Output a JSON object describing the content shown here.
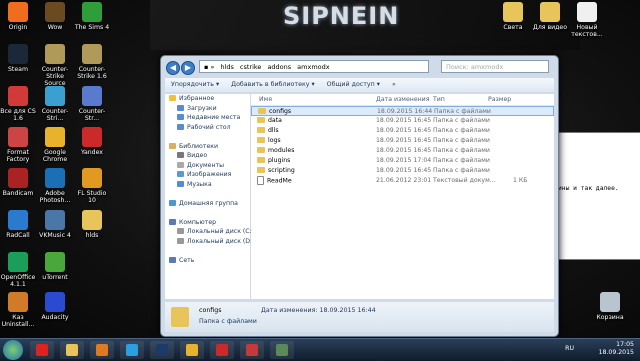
{
  "desktop": {
    "brand": "SIPNEIN",
    "icons_left": [
      {
        "label": "Origin",
        "color": "#f06d1f"
      },
      {
        "label": "Wow",
        "color": "#6b4a22"
      },
      {
        "label": "The Sims 4",
        "color": "#2f9e3a"
      },
      {
        "label": "Steam",
        "color": "#1b2838"
      },
      {
        "label": "Counter-Strike Source",
        "color": "#b09a5a"
      },
      {
        "label": "Counter-Strike 1.6",
        "color": "#b09a5a"
      },
      {
        "label": "Все для CS 1.6",
        "color": "#d23a3a"
      },
      {
        "label": "Counter-Stri...",
        "color": "#3aa0d0"
      },
      {
        "label": "Counter-Str...",
        "color": "#5a7ad0"
      },
      {
        "label": "Format Factory",
        "color": "#c44"
      },
      {
        "label": "Google Chrome",
        "color": "#e8b32a"
      },
      {
        "label": "Yandex",
        "color": "#cc2a2a"
      },
      {
        "label": "Bandicam",
        "color": "#a22"
      },
      {
        "label": "Adobe Photosh...",
        "color": "#1b6fb5"
      },
      {
        "label": "FL Studio 10",
        "color": "#e09a22"
      },
      {
        "label": "RadCall",
        "color": "#2a7ad0"
      },
      {
        "label": "VKMusic 4",
        "color": "#4a76a8"
      },
      {
        "label": "hlds",
        "color": "#e8c55a"
      },
      {
        "label": "OpenOffice 4.1.1",
        "color": "#1b9e5a"
      },
      {
        "label": "uTorrent",
        "color": "#4aa83a"
      },
      {
        "label": "Каз Uninstall...",
        "color": "#d07a2a"
      },
      {
        "label": "Audacity",
        "color": "#2a4ad0"
      }
    ],
    "icons_right": [
      {
        "label": "Света",
        "color": "#e8c55a"
      },
      {
        "label": "Для видео",
        "color": "#e8c55a"
      },
      {
        "label": "Новый текстов...",
        "color": "#f0f0f0"
      },
      {
        "label": "Корзина",
        "color": "#b8c4d0"
      }
    ]
  },
  "explorer": {
    "breadcrumb": [
      "hlds",
      "cstrike",
      "addons",
      "amxmodx"
    ],
    "search_placeholder": "Поиск: amxmodx",
    "toolbar": [
      "Упорядочить ▾",
      "Добавить в библиотеку ▾",
      "Общий доступ ▾",
      "»"
    ],
    "nav": [
      {
        "label": "Избранное",
        "color": "#f0c040",
        "indent": 0
      },
      {
        "label": "Загрузки",
        "color": "#5a8ad0",
        "indent": 1
      },
      {
        "label": "Недавние места",
        "color": "#5a8ad0",
        "indent": 1
      },
      {
        "label": "Рабочий стол",
        "color": "#5a8ad0",
        "indent": 1
      },
      {
        "label": "",
        "color": "",
        "indent": 0
      },
      {
        "label": "Библиотеки",
        "color": "#d8b060",
        "indent": 0
      },
      {
        "label": "Видео",
        "color": "#777",
        "indent": 1
      },
      {
        "label": "Документы",
        "color": "#aaa",
        "indent": 1
      },
      {
        "label": "Изображения",
        "color": "#5a9ad0",
        "indent": 1
      },
      {
        "label": "Музыка",
        "color": "#5a8ad0",
        "indent": 1
      },
      {
        "label": "",
        "color": "",
        "indent": 0
      },
      {
        "label": "Домашняя группа",
        "color": "#4a9ad0",
        "indent": 0
      },
      {
        "label": "",
        "color": "",
        "indent": 0
      },
      {
        "label": "Компьютер",
        "color": "#5a7ab0",
        "indent": 0
      },
      {
        "label": "Локальный диск (C:)",
        "color": "#999",
        "indent": 1
      },
      {
        "label": "Локальный диск (D:)",
        "color": "#999",
        "indent": 1
      },
      {
        "label": "",
        "color": "",
        "indent": 0
      },
      {
        "label": "Сеть",
        "color": "#5a7ab0",
        "indent": 0
      }
    ],
    "columns": [
      "Имя",
      "Дата изменения",
      "Тип",
      "Размер"
    ],
    "files": [
      {
        "name": "configs",
        "date": "18.09.2015 16:44",
        "type": "Папка с файлами",
        "size": "",
        "file": false,
        "sel": true
      },
      {
        "name": "data",
        "date": "18.09.2015 16:45",
        "type": "Папка с файлами",
        "size": "",
        "file": false,
        "sel": false
      },
      {
        "name": "dlls",
        "date": "18.09.2015 16:45",
        "type": "Папка с файлами",
        "size": "",
        "file": false,
        "sel": false
      },
      {
        "name": "logs",
        "date": "18.09.2015 16:45",
        "type": "Папка с файлами",
        "size": "",
        "file": false,
        "sel": false
      },
      {
        "name": "modules",
        "date": "18.09.2015 16:45",
        "type": "Папка с файлами",
        "size": "",
        "file": false,
        "sel": false
      },
      {
        "name": "plugins",
        "date": "18.09.2015 17:04",
        "type": "Папка с файлами",
        "size": "",
        "file": false,
        "sel": false
      },
      {
        "name": "scripting",
        "date": "18.09.2015 16:45",
        "type": "Папка с файлами",
        "size": "",
        "file": false,
        "sel": false
      },
      {
        "name": "ReadMe",
        "date": "21.06.2012 23:01",
        "type": "Текстовый докум...",
        "size": "1 КБ",
        "file": true,
        "sel": false
      }
    ],
    "details": {
      "name": "configs",
      "meta": "Дата изменения: 18.09.2015 16:44",
      "type": "Папка с файлами"
    }
  },
  "bgwindow": {
    "text": "ины и так далее."
  },
  "taskbar": {
    "apps": [
      {
        "name": "yandex-icon",
        "color": "#d22"
      },
      {
        "name": "folder-icon",
        "color": "#e8c55a"
      },
      {
        "name": "media-player-icon",
        "color": "#e07a22"
      },
      {
        "name": "skype-icon",
        "color": "#2aa0e0"
      },
      {
        "name": "photoshop-icon",
        "color": "#1b3a6a"
      },
      {
        "name": "chrome-icon",
        "color": "#e8b32a"
      },
      {
        "name": "yandex-browser-icon",
        "color": "#cc2a2a"
      },
      {
        "name": "flag-icon",
        "color": "#c43a3a"
      },
      {
        "name": "game-icon",
        "color": "#5a8a5a"
      }
    ],
    "lang": "RU",
    "time": "17:05",
    "date": "18.09.2015"
  }
}
